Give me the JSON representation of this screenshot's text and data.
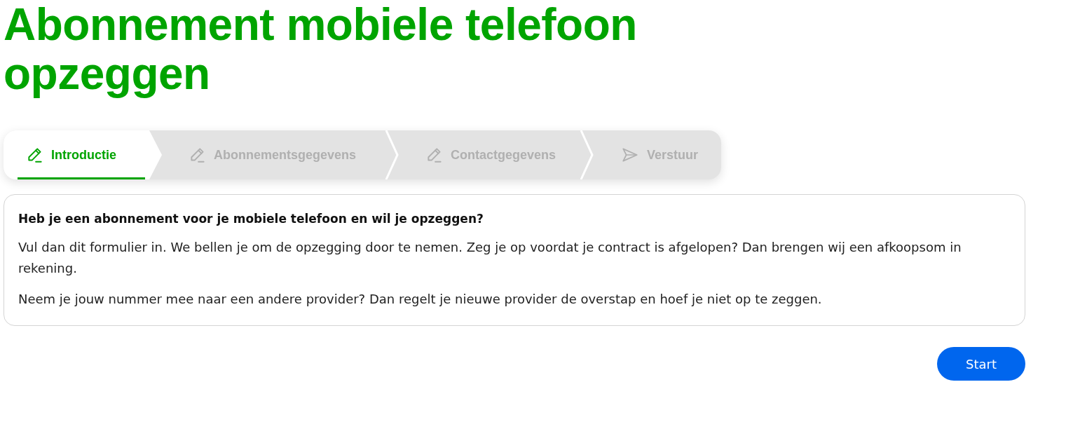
{
  "title": "Abonnement mobiele telefoon opzeggen",
  "steps": [
    {
      "label": "Introductie",
      "kind": "edit",
      "selected": true
    },
    {
      "label": "Abonnementsgegevens",
      "kind": "edit",
      "selected": false
    },
    {
      "label": "Contactgegevens",
      "kind": "edit",
      "selected": false
    },
    {
      "label": "Verstuur",
      "kind": "send",
      "selected": false
    }
  ],
  "card": {
    "heading": "Heb je een abonnement voor je mobiele telefoon en wil je opzeggen?",
    "paragraphs": [
      "Vul dan dit formulier in. We bellen je om de opzegging door te nemen. Zeg je op voordat je contract is afgelopen? Dan brengen wij een afkoopsom in rekening.",
      "Neem je jouw nummer mee naar een andere provider? Dan regelt je nieuwe provider de overstap en hoef je niet op te zeggen."
    ]
  },
  "button": {
    "label": "Start"
  }
}
